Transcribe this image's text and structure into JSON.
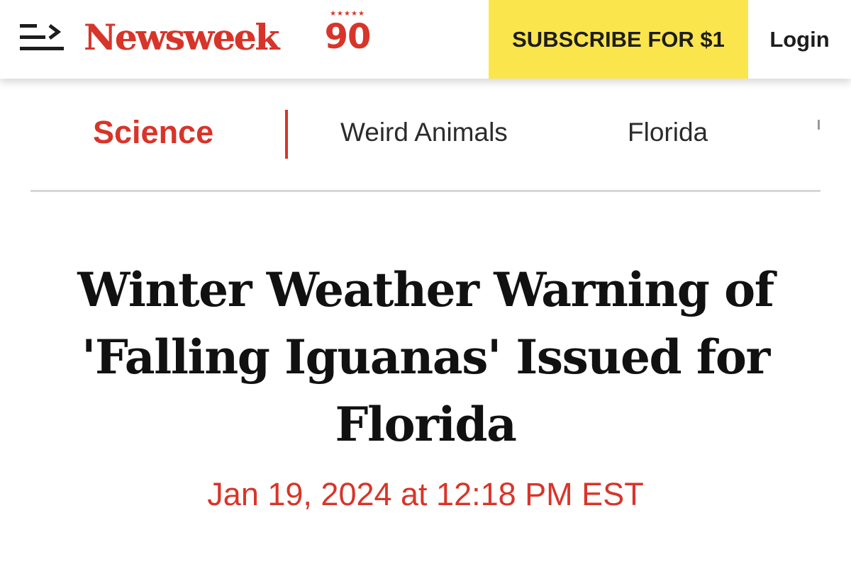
{
  "header": {
    "menu_icon": "menu-arrow-icon",
    "logo_text": "Newsweek",
    "anniversary_stars": "★★★★★",
    "anniversary_number": "90",
    "subscribe_label": "SUBSCRIBE FOR $1",
    "login_label": "Login"
  },
  "tags": {
    "primary": "Science",
    "items": [
      "Weird Animals",
      "Florida"
    ]
  },
  "article": {
    "headline": "Winter Weather Warning of 'Falling Iguanas' Issued for Florida",
    "dateline": "Jan 19, 2024 at 12:18 PM EST"
  },
  "colors": {
    "brand_red": "#d7352a",
    "subscribe_yellow": "#fbe54d",
    "text_dark": "#111111"
  }
}
